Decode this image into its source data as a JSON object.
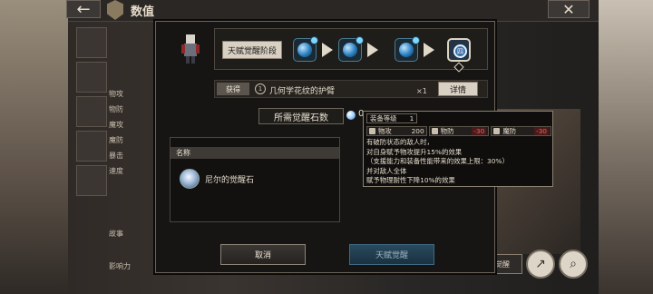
{
  "top_bar": {
    "title": "数值",
    "back_icon": "arrow-left-icon",
    "close_icon": "close-icon"
  },
  "background": {
    "stats": [
      {
        "label": "物攻"
      },
      {
        "label": "物防"
      },
      {
        "label": "魔攻"
      },
      {
        "label": "魔防"
      },
      {
        "label": "暴击"
      },
      {
        "label": "速度"
      }
    ],
    "lower": [
      {
        "label": "故事"
      },
      {
        "label": "影响力"
      }
    ],
    "bottom_button": "天赋觉醒",
    "round_buttons": [
      "share-icon",
      "search-icon"
    ]
  },
  "modal": {
    "stage_label": "天赋觉醒阶段",
    "final_stage_symbol": "四",
    "reward": {
      "tag": "获得",
      "icon_text": "1",
      "name": "几何学花纹的护臂",
      "qty": "×1",
      "detail_button": "详情"
    },
    "need": {
      "label": "所需觉醒石数",
      "count": "0"
    },
    "list": {
      "header": "名称",
      "item": "尼尔的觉醒石"
    },
    "buttons": {
      "cancel": "取消",
      "awaken": "天赋觉醒"
    }
  },
  "tooltip": {
    "level_label": "装备等级",
    "level_value": "1",
    "stats": [
      {
        "label": "物攻",
        "value": "200",
        "negative": false
      },
      {
        "label": "物防",
        "value": "-30",
        "negative": true
      },
      {
        "label": "魔防",
        "value": "-30",
        "negative": true
      }
    ],
    "desc": [
      "有破防状态的敌人时，",
      "对自身赋予物攻提升15%的效果",
      "（支援能力和装备性能带来的效果上限：30%）",
      "并对敌人全体",
      "赋予物理耐性下降10%的效果"
    ]
  },
  "colors": {
    "accent": "#d8d1c3",
    "negative": "#ff5a5a",
    "orb": "#2a7ec0"
  }
}
